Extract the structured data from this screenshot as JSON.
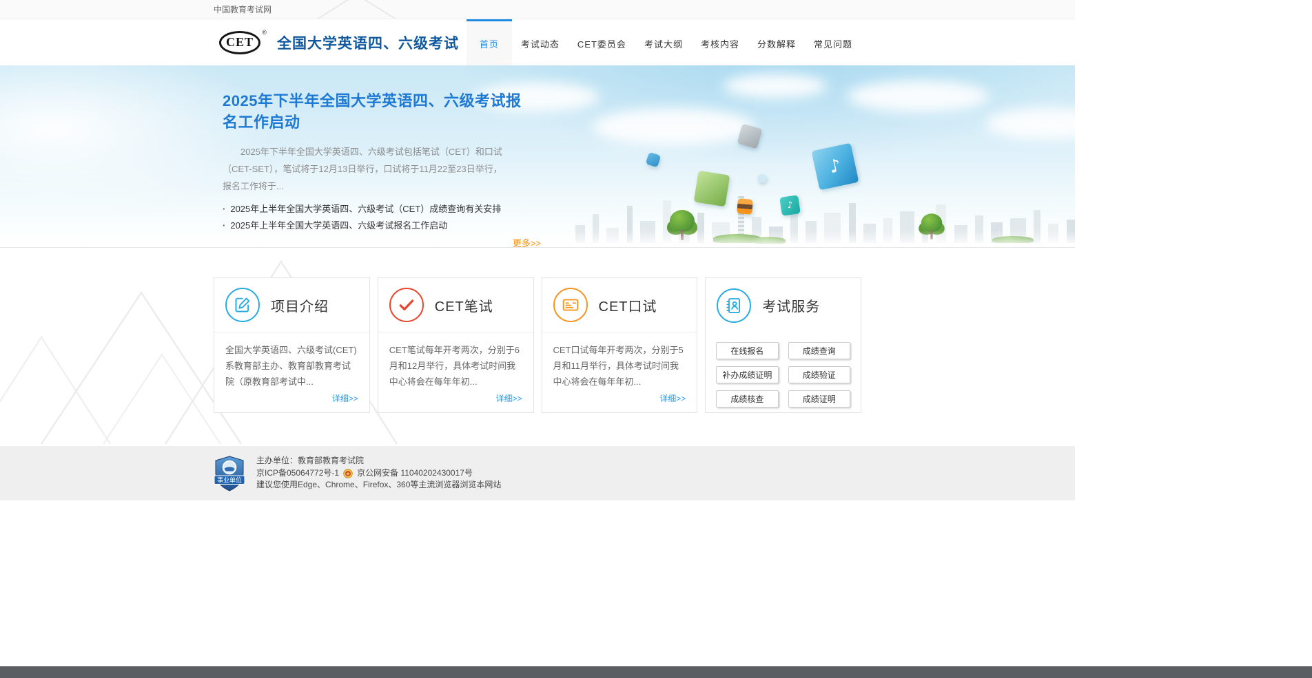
{
  "topbar": {
    "site_name": "中国教育考试网"
  },
  "header": {
    "logo_text": "CET",
    "logo_reg": "®",
    "title": "全国大学英语四、六级考试",
    "nav": [
      {
        "label": "首页",
        "active": true
      },
      {
        "label": "考试动态",
        "active": false
      },
      {
        "label": "CET委员会",
        "active": false
      },
      {
        "label": "考试大纲",
        "active": false
      },
      {
        "label": "考核内容",
        "active": false
      },
      {
        "label": "分数解释",
        "active": false
      },
      {
        "label": "常见问题",
        "active": false
      }
    ]
  },
  "hero": {
    "title": "2025年下半年全国大学英语四、六级考试报名工作启动",
    "excerpt": "2025年下半年全国大学英语四、六级考试包括笔试（CET）和口试（CET-SET），笔试将于12月13日举行，口试将于11月22至23日举行，报名工作将于...",
    "news": [
      "2025年上半年全国大学英语四、六级考试（CET）成绩查询有关安排",
      "2025年上半年全国大学英语四、六级考试报名工作启动"
    ],
    "more_label": "更多>>",
    "music_note": "♪"
  },
  "cards": [
    {
      "title": "项目介绍",
      "icon": "compose-icon",
      "accent": "#29abe2",
      "body": "全国大学英语四、六级考试(CET)系教育部主办、教育部教育考试院（原教育部考试中...",
      "link": "详细>>"
    },
    {
      "title": "CET笔试",
      "icon": "checkmark-icon",
      "accent": "#e8452c",
      "body": "CET笔试每年开考两次，分别于6月和12月举行，具体考试时间我中心将会在每年年初...",
      "link": "详细>>"
    },
    {
      "title": "CET口试",
      "icon": "id-card-icon",
      "accent": "#f7941e",
      "body": "CET口试每年开考两次，分别于5月和11月举行，具体考试时间我中心将会在每年年初...",
      "link": "详细>>"
    },
    {
      "title": "考试服务",
      "icon": "notebook-icon",
      "accent": "#29abe2",
      "services": [
        "在线报名",
        "成绩查询",
        "补办成绩证明",
        "成绩验证",
        "成绩核查",
        "成绩证明"
      ]
    }
  ],
  "footer": {
    "badge_label": "事业单位",
    "organizer": "主办单位：教育部教育考试院",
    "icp": "京ICP备05064772号-1",
    "police": "京公网安备 11040202430017号",
    "browser_tip": "建议您使用Edge、Chrome、Firefox、360等主流浏览器浏览本网站"
  },
  "colors": {
    "accent_blue": "#1e88e5",
    "title_blue": "#10599e",
    "hero_title_blue": "#1d79d3",
    "link_blue": "#2b9ae8",
    "more_orange": "#ff8a00",
    "card_blue": "#29abe2",
    "card_red": "#e8452c",
    "card_orange": "#f7941e",
    "footer_bg": "#efefef",
    "bottom_bar": "#5b5e62"
  }
}
